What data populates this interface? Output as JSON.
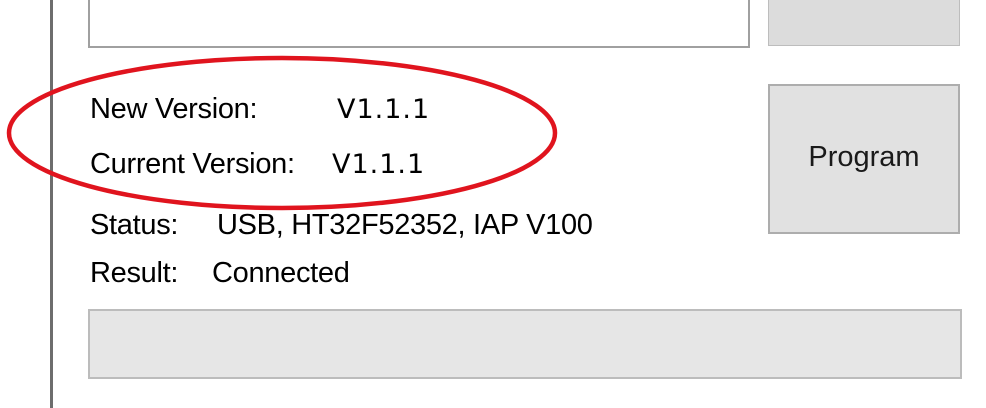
{
  "version_info": {
    "new_version_label": "New Version:",
    "new_version_value": "V1.1.1",
    "current_version_label": "Current Version:",
    "current_version_value": "V1.1.1"
  },
  "status": {
    "label": "Status:",
    "value": "USB, HT32F52352, IAP V100"
  },
  "result": {
    "label": "Result:",
    "value": "Connected"
  },
  "buttons": {
    "program_label": "Program"
  },
  "progress": {
    "fraction": 0
  },
  "colors": {
    "annotation_ellipse": "#e0141e",
    "button_face": "#e1e1e1",
    "progress_fill": "#06b025"
  }
}
